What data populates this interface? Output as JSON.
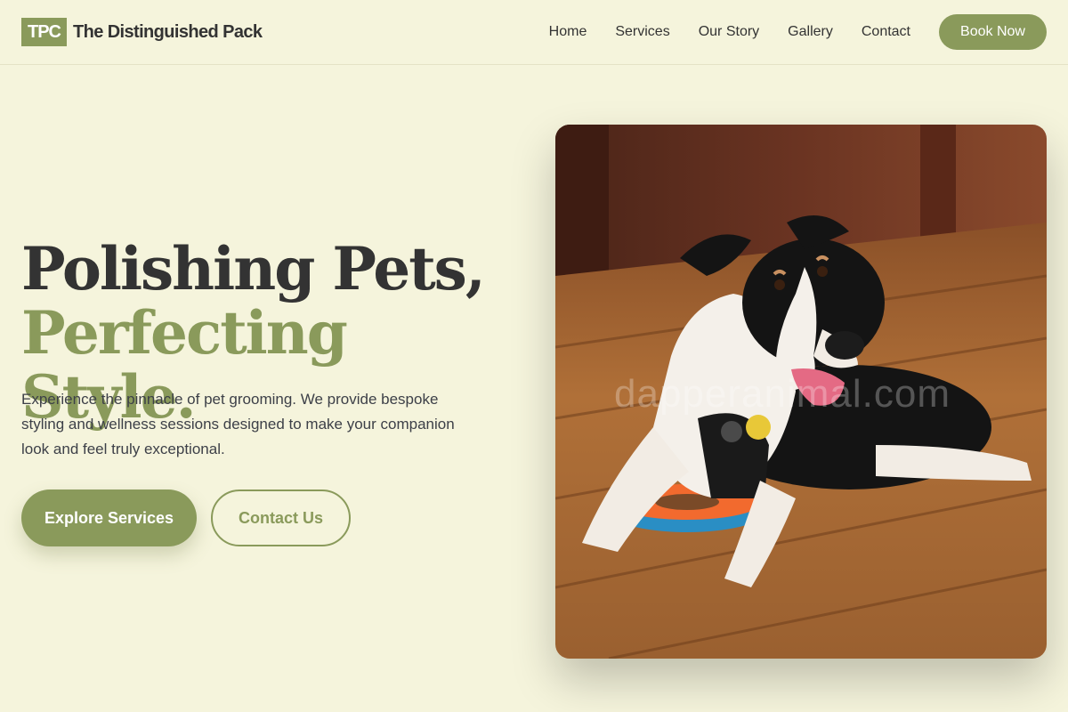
{
  "brand": {
    "logo_text": "TPC",
    "name": "The Distinguished Pack"
  },
  "nav": {
    "items": [
      "Home",
      "Services",
      "Our Story",
      "Gallery",
      "Contact"
    ],
    "cta_label": "Book Now"
  },
  "hero": {
    "title_line1": "Polishing Pets,",
    "title_line2": "Perfecting Style.",
    "description": "Experience the pinnacle of pet grooming. We provide bespoke styling and wellness sessions designed to make your companion look and feel truly exceptional.",
    "primary_button": "Explore Services",
    "secondary_button": "Contact Us",
    "image_watermark": "dapperanimal.com"
  },
  "colors": {
    "background": "#f5f4dc",
    "accent": "#8a9a5b",
    "text_dark": "#333333"
  }
}
